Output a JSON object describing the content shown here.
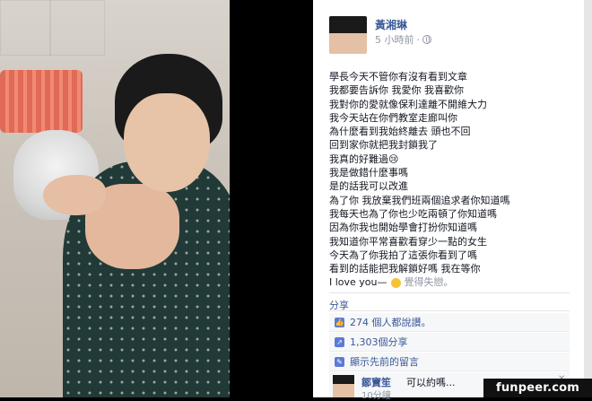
{
  "post": {
    "author": "黃湘琳",
    "time": "5 小時前",
    "lines": [
      "學長今天不管你有沒有看到文章",
      "我都要告訴你 我愛你 我喜歡你",
      "我對你的愛就像保利達離不開維大力",
      "我今天站在你們教室走廊叫你",
      "為什麼看到我始終離去 頭也不回",
      "回到家你就把我封鎖我了",
      "我真的好難過😢",
      "我是做錯什麼事嗎",
      "是的話我可以改進",
      "為了你 我放棄我們班兩個追求者你知道嗎",
      "我每天也為了你也少吃兩頓了你知道嗎",
      "因為你我也開始學會打扮你知道嗎",
      "我知道你平常喜歡看穿少一點的女生",
      "今天為了你我拍了這張你看到了嗎",
      "看到的話能把我解鎖好嗎 我在等你"
    ],
    "love_text": "I love you—",
    "feeling": "覺得失戀。"
  },
  "actions": {
    "share": "分享",
    "likes": "274 個人都說讚。",
    "shares": "1,303個分享",
    "prev_comments": "顯示先前的留言"
  },
  "comment": {
    "name": "鄒寶笙",
    "text": "可以約嗎...",
    "time": "10分鐘"
  },
  "watermark": "funpeer.com"
}
